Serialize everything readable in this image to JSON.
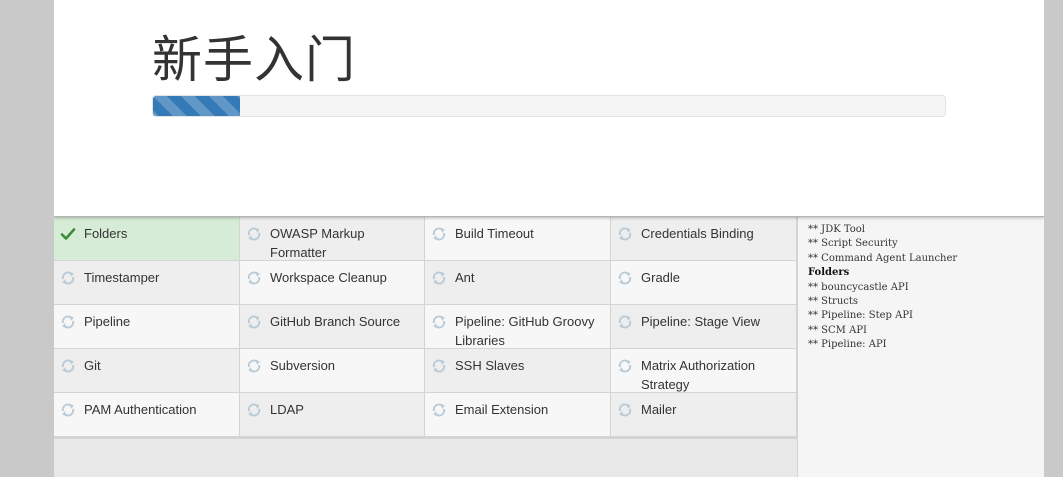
{
  "header": {
    "title": "新手入门",
    "progress_fraction": 0.11
  },
  "plugins": [
    {
      "name": "Folders",
      "status": "success"
    },
    {
      "name": "OWASP Markup Formatter",
      "status": "pending"
    },
    {
      "name": "Build Timeout",
      "status": "pending"
    },
    {
      "name": "Credentials Binding",
      "status": "pending"
    },
    {
      "name": "Timestamper",
      "status": "pending"
    },
    {
      "name": "Workspace Cleanup",
      "status": "pending"
    },
    {
      "name": "Ant",
      "status": "pending"
    },
    {
      "name": "Gradle",
      "status": "pending"
    },
    {
      "name": "Pipeline",
      "status": "pending"
    },
    {
      "name": "GitHub Branch Source",
      "status": "pending"
    },
    {
      "name": "Pipeline: GitHub Groovy Libraries",
      "status": "pending"
    },
    {
      "name": "Pipeline: Stage View",
      "status": "pending"
    },
    {
      "name": "Git",
      "status": "pending"
    },
    {
      "name": "Subversion",
      "status": "pending"
    },
    {
      "name": "SSH Slaves",
      "status": "pending"
    },
    {
      "name": "Matrix Authorization Strategy",
      "status": "pending"
    },
    {
      "name": "PAM Authentication",
      "status": "pending"
    },
    {
      "name": "LDAP",
      "status": "pending"
    },
    {
      "name": "Email Extension",
      "status": "pending"
    },
    {
      "name": "Mailer",
      "status": "pending"
    }
  ],
  "log": [
    {
      "text": "** JDK Tool",
      "bold": false
    },
    {
      "text": "** Script Security",
      "bold": false
    },
    {
      "text": "** Command Agent Launcher",
      "bold": false
    },
    {
      "text": "Folders",
      "bold": true
    },
    {
      "text": "** bouncycastle API",
      "bold": false
    },
    {
      "text": "** Structs",
      "bold": false
    },
    {
      "text": "** Pipeline: Step API",
      "bold": false
    },
    {
      "text": "** SCM API",
      "bold": false
    },
    {
      "text": "** Pipeline: API",
      "bold": false
    }
  ],
  "colors": {
    "progress": "#337ab7",
    "success_bg": "#d6ecd6",
    "success_icon": "#3c8c3c",
    "pending_icon": "#b9cbd6"
  },
  "icons": {
    "success": "checkmark-icon",
    "pending": "refresh-icon"
  }
}
